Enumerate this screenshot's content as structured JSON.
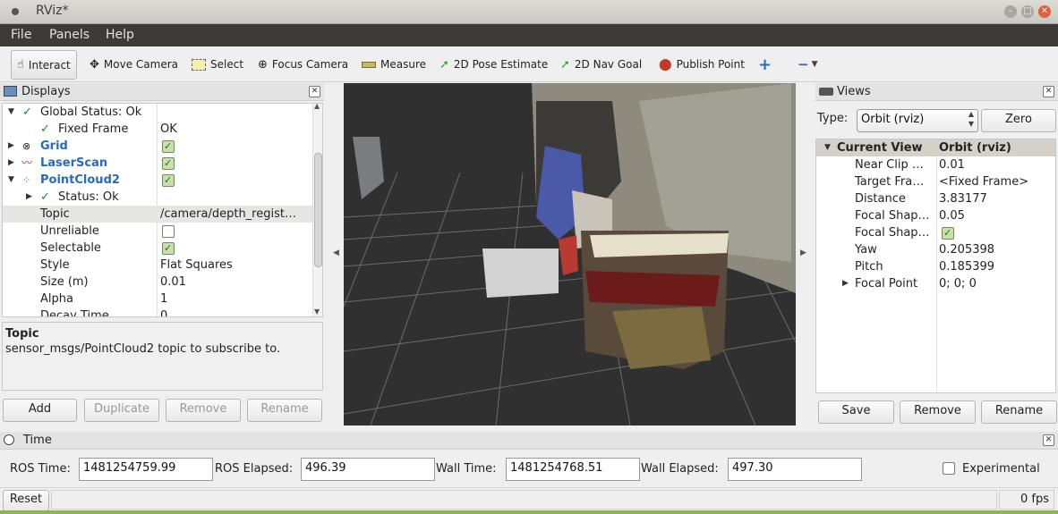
{
  "window": {
    "title": "RViz*"
  },
  "menu": [
    "File",
    "Panels",
    "Help"
  ],
  "toolbar": {
    "interact": "Interact",
    "move_camera": "Move Camera",
    "select": "Select",
    "focus_camera": "Focus Camera",
    "measure": "Measure",
    "pose_estimate": "2D Pose Estimate",
    "nav_goal": "2D Nav Goal",
    "publish_point": "Publish Point"
  },
  "displays": {
    "title": "Displays",
    "rows": [
      {
        "label": "Global Status: Ok",
        "value": ""
      },
      {
        "label": "Fixed Frame",
        "value": "OK"
      },
      {
        "label": "Grid",
        "value": ""
      },
      {
        "label": "LaserScan",
        "value": ""
      },
      {
        "label": "PointCloud2",
        "value": ""
      },
      {
        "label": "Status: Ok",
        "value": ""
      },
      {
        "label": "Topic",
        "value": "/camera/depth_regist…"
      },
      {
        "label": "Unreliable",
        "value": ""
      },
      {
        "label": "Selectable",
        "value": ""
      },
      {
        "label": "Style",
        "value": "Flat Squares"
      },
      {
        "label": "Size (m)",
        "value": "0.01"
      },
      {
        "label": "Alpha",
        "value": "1"
      },
      {
        "label": "Decay Time",
        "value": "0"
      }
    ],
    "help_title": "Topic",
    "help_text": "sensor_msgs/PointCloud2 topic to subscribe to.",
    "buttons": {
      "add": "Add",
      "duplicate": "Duplicate",
      "remove": "Remove",
      "rename": "Rename"
    }
  },
  "views": {
    "title": "Views",
    "type_label": "Type:",
    "type_value": "Orbit (rviz)",
    "zero": "Zero",
    "header": {
      "name": "Current View",
      "value": "Orbit (rviz)"
    },
    "rows": [
      {
        "label": "Near Clip …",
        "value": "0.01"
      },
      {
        "label": "Target Fra…",
        "value": "<Fixed Frame>"
      },
      {
        "label": "Distance",
        "value": "3.83177"
      },
      {
        "label": "Focal Shap…",
        "value": "0.05"
      },
      {
        "label": "Focal Shap…",
        "value": ""
      },
      {
        "label": "Yaw",
        "value": "0.205398"
      },
      {
        "label": "Pitch",
        "value": "0.185399"
      },
      {
        "label": "Focal Point",
        "value": "0; 0; 0"
      }
    ],
    "buttons": {
      "save": "Save",
      "remove": "Remove",
      "rename": "Rename"
    }
  },
  "time": {
    "title": "Time",
    "ros_time_label": "ROS Time:",
    "ros_time": "1481254759.99",
    "ros_elapsed_label": "ROS Elapsed:",
    "ros_elapsed": "496.39",
    "wall_time_label": "Wall Time:",
    "wall_time": "1481254768.51",
    "wall_elapsed_label": "Wall Elapsed:",
    "wall_elapsed": "497.30",
    "experimental": "Experimental"
  },
  "status": {
    "reset": "Reset",
    "fps": "0 fps"
  },
  "colors": {
    "link_blue": "#2a6ab8",
    "viewport_bg": "#303030",
    "tree_header": "#d5d0c8"
  }
}
